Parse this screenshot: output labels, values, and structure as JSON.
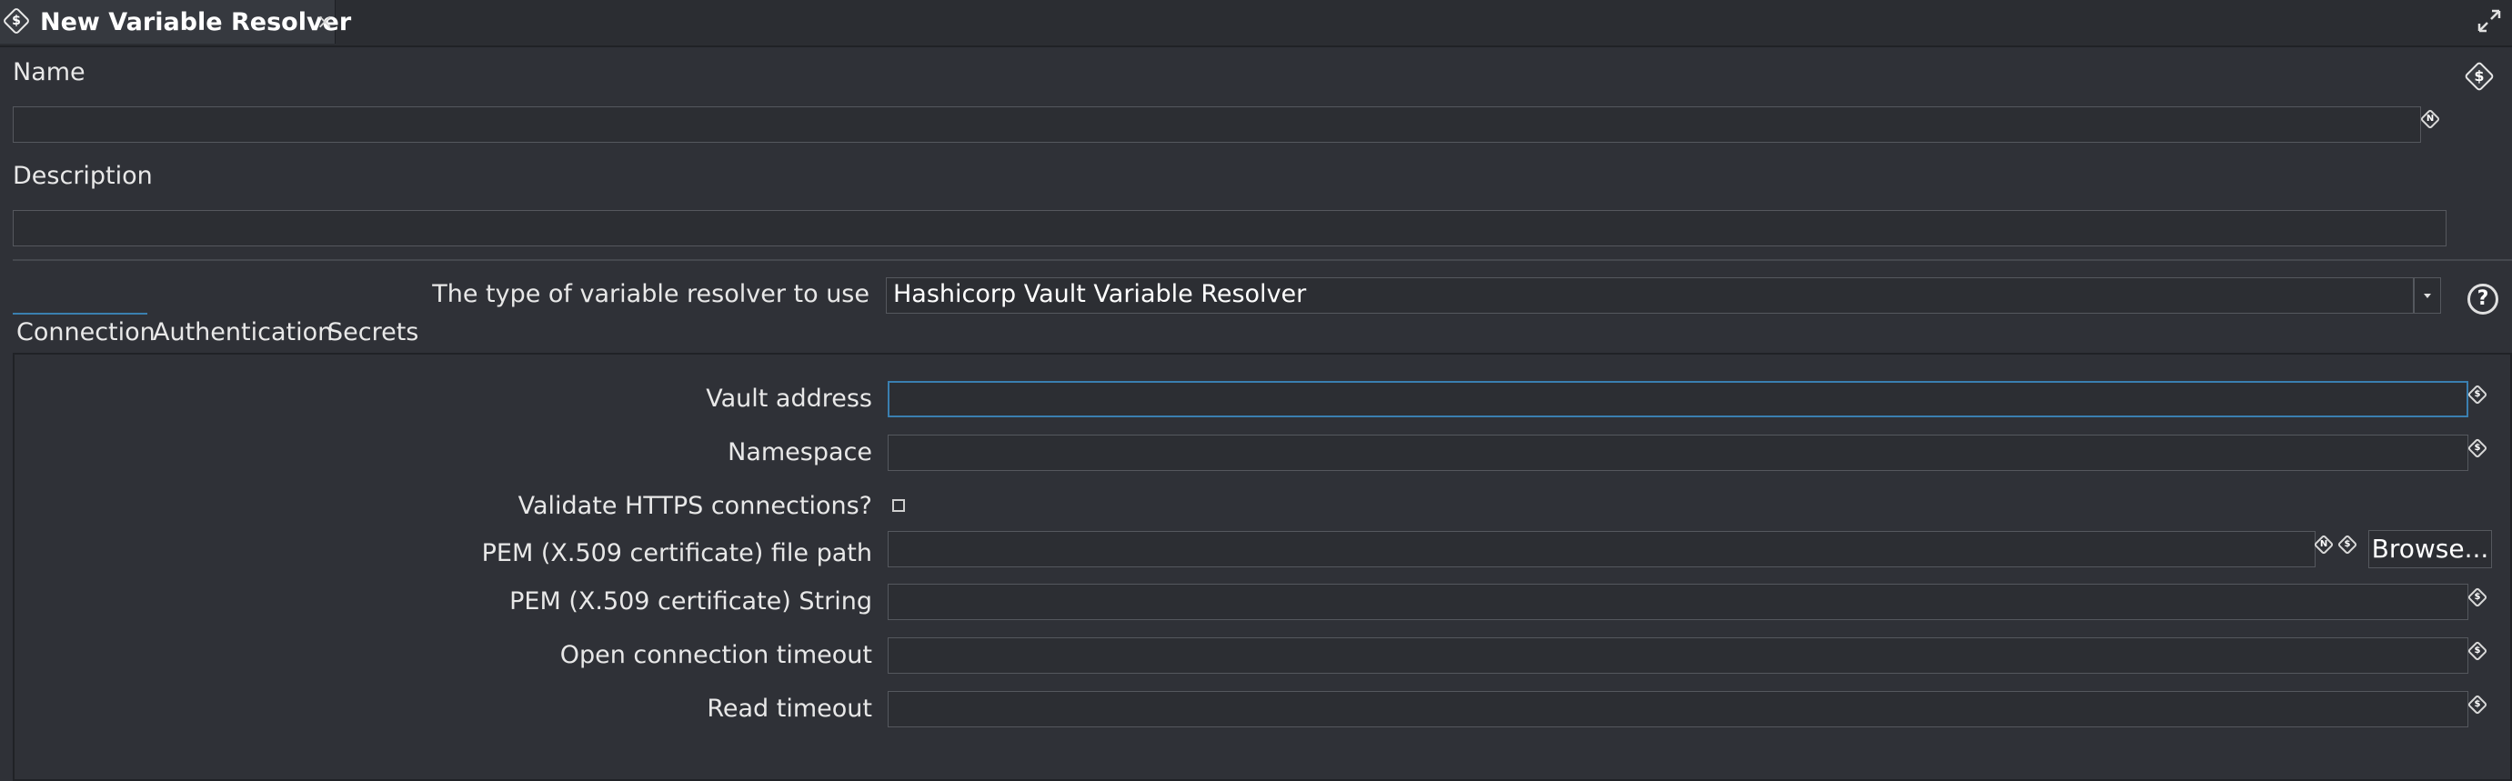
{
  "tab": {
    "title": "New Variable Resolver",
    "close": "×",
    "icon": "variable-resolver-icon"
  },
  "form": {
    "name_label": "Name",
    "name_value": "",
    "description_label": "Description",
    "description_value": "",
    "type_label": "The type of variable resolver to use",
    "type_value": "Hashicorp Vault Variable Resolver"
  },
  "tabs": [
    "Connection",
    "Authentication",
    "Secrets"
  ],
  "connection": {
    "vault_address_label": "Vault address",
    "vault_address_value": "",
    "namespace_label": "Namespace",
    "namespace_value": "",
    "validate_https_label": "Validate HTTPS connections?",
    "validate_https_checked": false,
    "pem_path_label": "PEM (X.509 certificate) file path",
    "pem_path_value": "",
    "browse_label": "Browse...",
    "pem_string_label": "PEM (X.509 certificate) String",
    "pem_string_value": "",
    "open_timeout_label": "Open connection timeout",
    "open_timeout_value": "",
    "read_timeout_label": "Read timeout",
    "read_timeout_value": ""
  },
  "icons": {
    "variable": "$",
    "disabled_variable": "N",
    "help": "?",
    "maximize": "maximize-icon",
    "dropdown": "▾"
  }
}
